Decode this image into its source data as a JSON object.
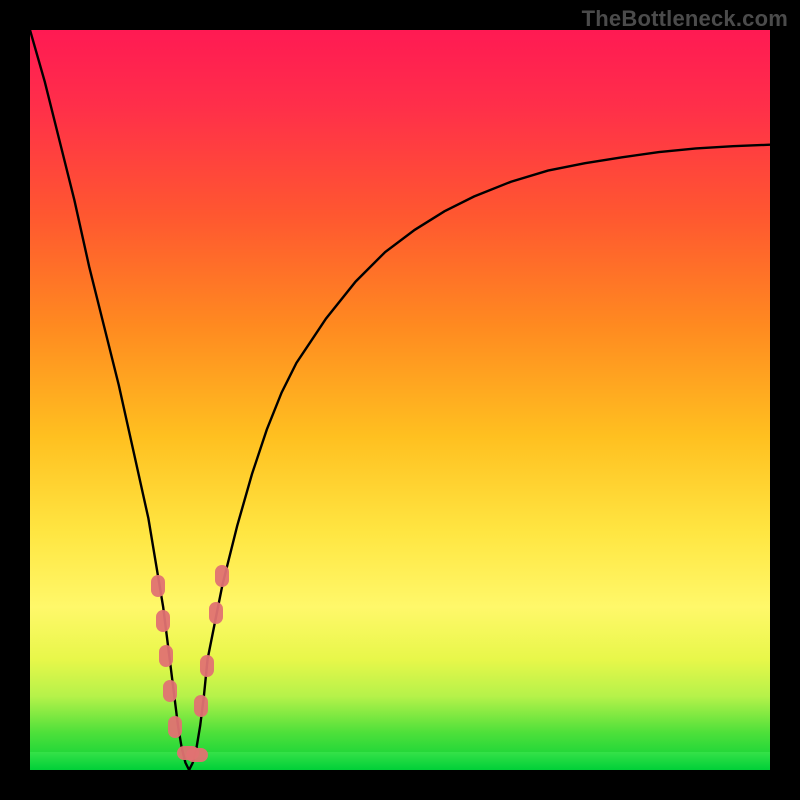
{
  "watermark": "TheBottleneck.com",
  "chart_data": {
    "type": "line",
    "title": "",
    "xlabel": "",
    "ylabel": "",
    "xlim": [
      0,
      100
    ],
    "ylim": [
      0,
      100
    ],
    "grid": false,
    "colors": {
      "curve": "#000000",
      "markers": "#e07272",
      "gradient_top": "#ff1a53",
      "gradient_bottom": "#00d038"
    },
    "series": [
      {
        "name": "curve",
        "x": [
          0,
          2,
          4,
          6,
          8,
          10,
          12,
          14,
          16,
          17,
          18,
          18.5,
          19,
          19.5,
          20,
          20.5,
          21,
          21.5,
          22,
          22.5,
          23,
          23.5,
          24,
          26,
          28,
          30,
          32,
          34,
          36,
          38,
          40,
          44,
          48,
          52,
          56,
          60,
          65,
          70,
          75,
          80,
          85,
          90,
          95,
          100
        ],
        "y": [
          100,
          93,
          85,
          77,
          68,
          60,
          52,
          43,
          34,
          28,
          22,
          18,
          14,
          10,
          6,
          3,
          1,
          0,
          1,
          3,
          6,
          10,
          15,
          25,
          33,
          40,
          46,
          51,
          55,
          58,
          61,
          66,
          70,
          73,
          75.5,
          77.5,
          79.5,
          81,
          82,
          82.8,
          83.5,
          84,
          84.3,
          84.5
        ]
      }
    ],
    "markers": [
      {
        "x": 17.3,
        "y": 25
      },
      {
        "x": 18.0,
        "y": 20
      },
      {
        "x": 18.4,
        "y": 15
      },
      {
        "x": 19.0,
        "y": 10
      },
      {
        "x": 19.6,
        "y": 5
      },
      {
        "x": 20.8,
        "y": 1
      },
      {
        "x": 22.0,
        "y": 1.2
      },
      {
        "x": 23.2,
        "y": 8
      },
      {
        "x": 24.0,
        "y": 14
      },
      {
        "x": 25.2,
        "y": 21
      },
      {
        "x": 26.0,
        "y": 26
      }
    ]
  }
}
